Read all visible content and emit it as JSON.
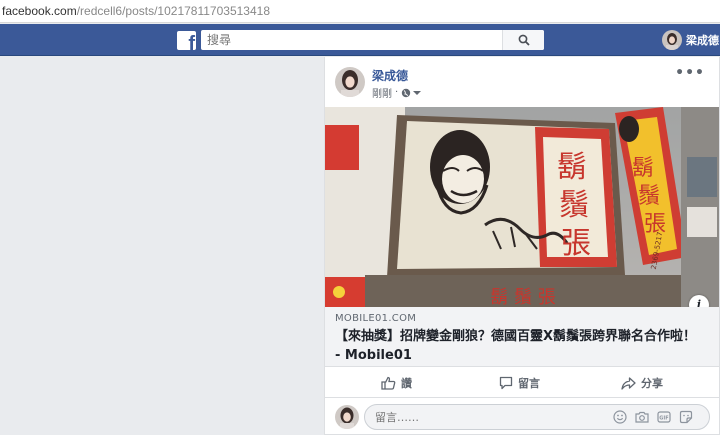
{
  "browser": {
    "url_domain": "facebook.com",
    "url_path": "/redcell6/posts/10217811703513418"
  },
  "header": {
    "logo_letter": "f",
    "search_placeholder": "搜尋",
    "profile_name": "梁成德",
    "brand_color": "#3b5998"
  },
  "post": {
    "author": "梁成德",
    "time": "剛剛",
    "privacy_icon": "globe-icon",
    "more_label": "•••",
    "link": {
      "image_signs": {
        "sign_main": [
          "鬍",
          "鬚",
          "張"
        ],
        "sign_side": [
          "鬍",
          "鬚",
          "張"
        ],
        "sign_bottom": "鬍 鬚 張",
        "sign_phone": "2369-5217"
      },
      "info_label": "i",
      "domain": "MOBILE01.COM",
      "title": "【來抽獎】招牌變金剛狼？德國百靈X鬍鬚張跨界聯名合作啦！ - Mobile01"
    },
    "actions": {
      "like": "讚",
      "comment": "留言",
      "share": "分享"
    },
    "comment_placeholder": "留言……"
  }
}
